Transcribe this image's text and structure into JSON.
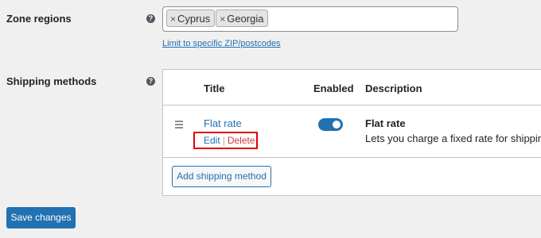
{
  "zone_regions": {
    "label": "Zone regions",
    "help_icon": "question-circle-icon",
    "chips": [
      {
        "remove": "×",
        "label": "Cyprus"
      },
      {
        "remove": "×",
        "label": "Georgia"
      }
    ],
    "limit_link": "Limit to specific ZIP/postcodes"
  },
  "shipping_methods": {
    "label": "Shipping methods",
    "help_icon": "question-circle-icon",
    "headers": {
      "title": "Title",
      "enabled": "Enabled",
      "description": "Description"
    },
    "rows": [
      {
        "title": "Flat rate",
        "enabled": true,
        "edit_label": "Edit",
        "separator": "|",
        "delete_label": "Delete",
        "description_title": "Flat rate",
        "description_text": "Lets you charge a fixed rate for shipping."
      }
    ],
    "add_button": "Add shipping method"
  },
  "save_button": "Save changes",
  "colors": {
    "accent": "#2271b1",
    "highlight_box": "#e3000f",
    "delete": "#d63638",
    "background": "#f0f0f1"
  }
}
